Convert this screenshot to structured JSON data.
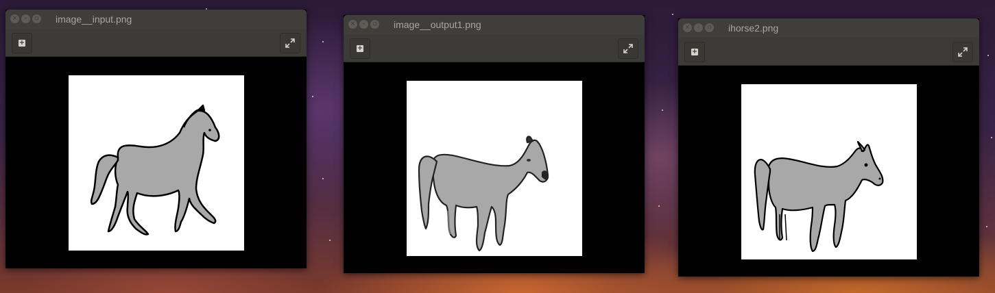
{
  "windows": [
    {
      "title": "image__input.png",
      "close_glyph": "×",
      "minimize_glyph": "–",
      "maximize_glyph": "▫",
      "add_icon": "plus-icon",
      "fullscreen_icon": "fullscreen-icon"
    },
    {
      "title": "image__output1.png",
      "close_glyph": "×",
      "minimize_glyph": "–",
      "maximize_glyph": "▫",
      "add_icon": "plus-icon",
      "fullscreen_icon": "fullscreen-icon"
    },
    {
      "title": "ihorse2.png",
      "close_glyph": "×",
      "minimize_glyph": "–",
      "maximize_glyph": "▫",
      "add_icon": "plus-icon",
      "fullscreen_icon": "fullscreen-icon"
    }
  ],
  "colors": {
    "titlebar": "#403e3a",
    "toolbar": "#3d3b37",
    "title_text": "#a8a69f",
    "horse_fill": "#a8a8a8",
    "horse_stroke": "#000000"
  }
}
